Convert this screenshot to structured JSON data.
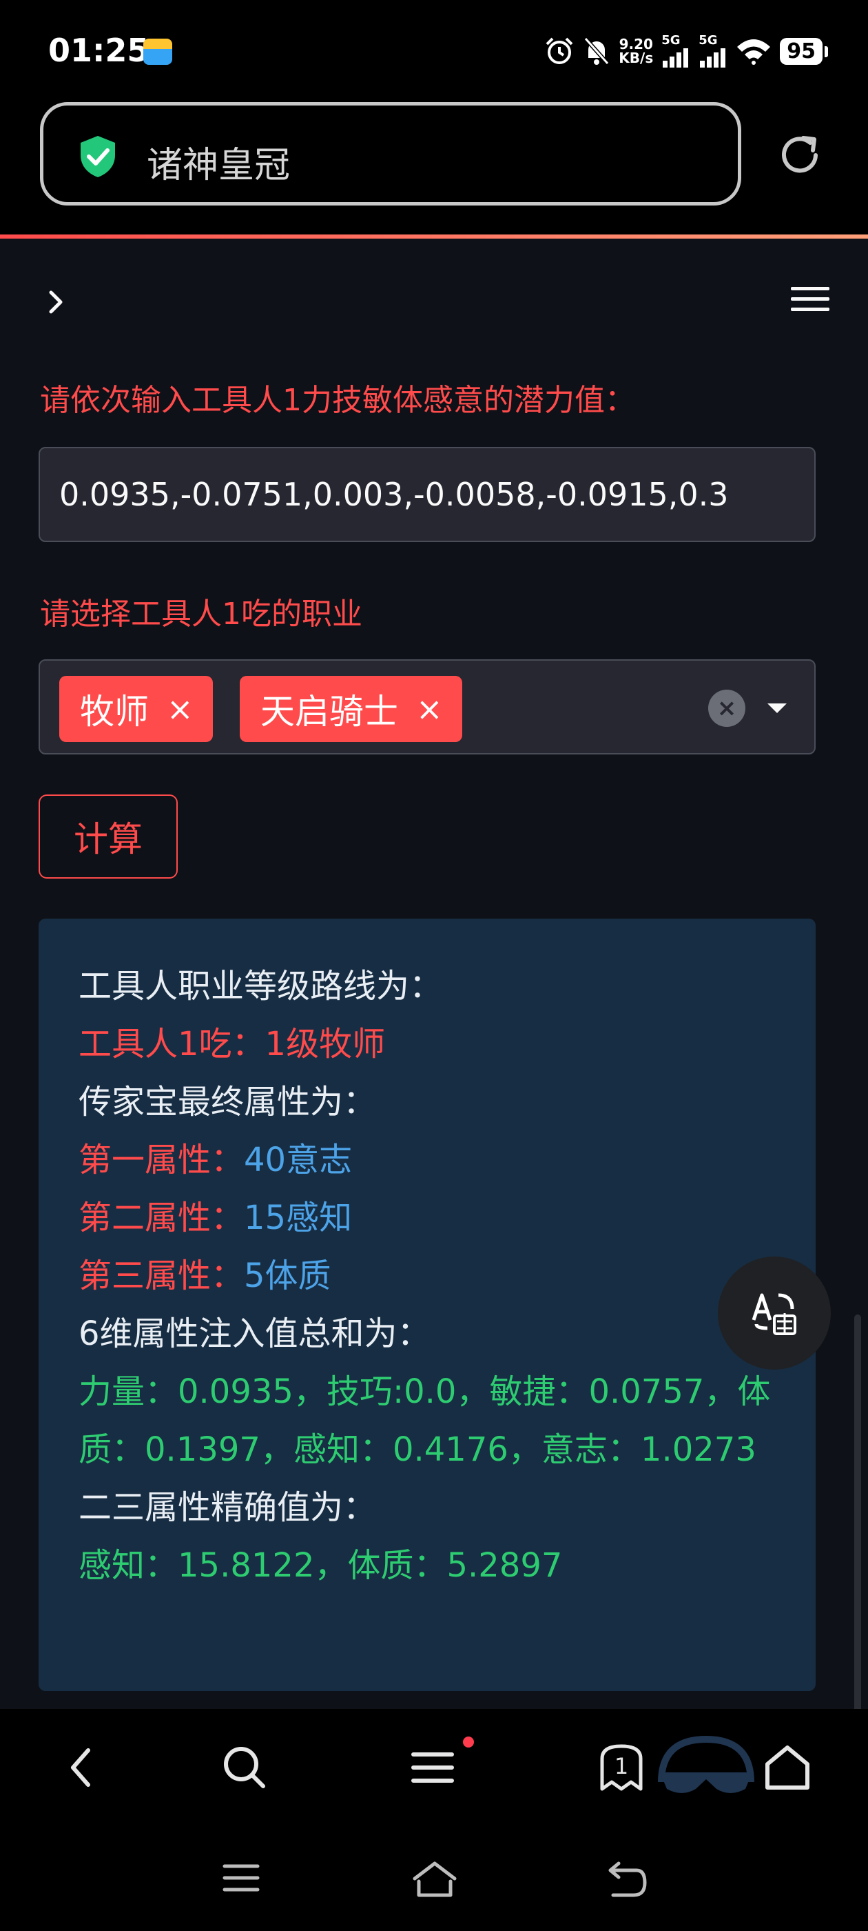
{
  "status_bar": {
    "time": "01:25",
    "speed_value": "9.20",
    "speed_unit": "KB/s",
    "net1": "5G",
    "net2": "5G",
    "battery": "95"
  },
  "address_bar": {
    "title": "诸神皇冠"
  },
  "form": {
    "potential_label": "请依次输入工具人1力技敏体感意的潜力值：",
    "potential_value": "0.0935,-0.0751,0.003,-0.0058,-0.0915,0.3",
    "job_label": "请选择工具人1吃的职业",
    "jobs": [
      "牧师",
      "天启骑士"
    ],
    "tag_remove": "×",
    "clear_all": "×",
    "calc_label": "计算"
  },
  "result": {
    "route_heading": "工具人职业等级路线为：",
    "route_line": "工具人1吃：1级牧师",
    "heirloom_heading": "传家宝最终属性为：",
    "attrs": [
      {
        "label": "第一属性：",
        "value": "40意志"
      },
      {
        "label": "第二属性：",
        "value": "15感知"
      },
      {
        "label": "第三属性：",
        "value": "5体质"
      }
    ],
    "sum_heading": "6维属性注入值总和为：",
    "sum_values": "力量：0.0935，技巧:0.0，敏捷：0.0757，体质：0.1397，感知：0.4176，意志：1.0273",
    "precise_heading": "二三属性精确值为：",
    "precise_values": "感知：15.8122，体质：5.2897"
  },
  "bottom_bar": {
    "tab_count": "1"
  },
  "colors": {
    "accent": "#ff4b4b",
    "app_bg": "#0e1117",
    "result_bg": "#172d43",
    "value_blue": "#4da3e8",
    "value_green": "#2ecc71"
  }
}
